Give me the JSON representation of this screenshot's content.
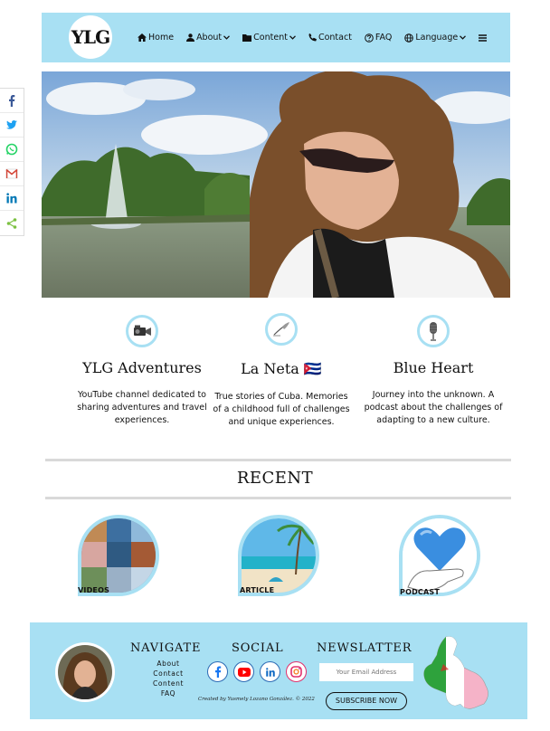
{
  "header": {
    "logo_text": "YLG",
    "nav": [
      {
        "label": "Home",
        "icon": "home-icon"
      },
      {
        "label": "About",
        "icon": "user-icon",
        "dropdown": true
      },
      {
        "label": "Content",
        "icon": "folder-icon",
        "dropdown": true
      },
      {
        "label": "Contact",
        "icon": "phone-icon"
      },
      {
        "label": "FAQ",
        "icon": "question-icon"
      },
      {
        "label": "Language",
        "icon": "globe-icon",
        "dropdown": true
      }
    ],
    "menu_icon": "hamburger-menu-icon"
  },
  "share": {
    "icons": [
      "facebook-icon",
      "twitter-icon",
      "whatsapp-icon",
      "gmail-icon",
      "linkedin-icon",
      "share-icon"
    ]
  },
  "hero": {
    "image": "hero-photo-curly-hair-fountain-lake"
  },
  "features": [
    {
      "title": "YLG Adventures",
      "description": "YouTube channel dedicated to sharing adventures and travel experiences.",
      "icon": "video-camera-icon"
    },
    {
      "title": "La Neta 🇨🇺",
      "description": "True stories of Cuba. Memories of a childhood full of challenges and unique experiences.",
      "icon": "quill-pen-icon"
    },
    {
      "title": "Blue Heart",
      "description": "Journey into the unknown. A podcast about the challenges of adapting to a new culture.",
      "icon": "microphone-icon"
    }
  ],
  "recent": {
    "title": "RECENT",
    "cards": [
      {
        "label": "VIDEOS"
      },
      {
        "label": "ARTICLE"
      },
      {
        "label": "PODCAST"
      }
    ]
  },
  "footer": {
    "navigate_title": "NAVIGATE",
    "links": [
      "About",
      "Contact",
      "Content",
      "FAQ"
    ],
    "social_title": "SOCIAL",
    "social_icons": [
      "facebook-icon",
      "youtube-icon",
      "linkedin-icon",
      "instagram-icon"
    ],
    "credit": "Created by Yusmely Lozano González. © 2022",
    "newsletter_title": "NEWSLATTER",
    "email_placeholder": "Your Email Address",
    "subscribe_label": "SUBSCRIBE NOW"
  },
  "colors": {
    "accent": "#a8e0f3",
    "text": "#111111",
    "rule": "#d9d9d9"
  }
}
